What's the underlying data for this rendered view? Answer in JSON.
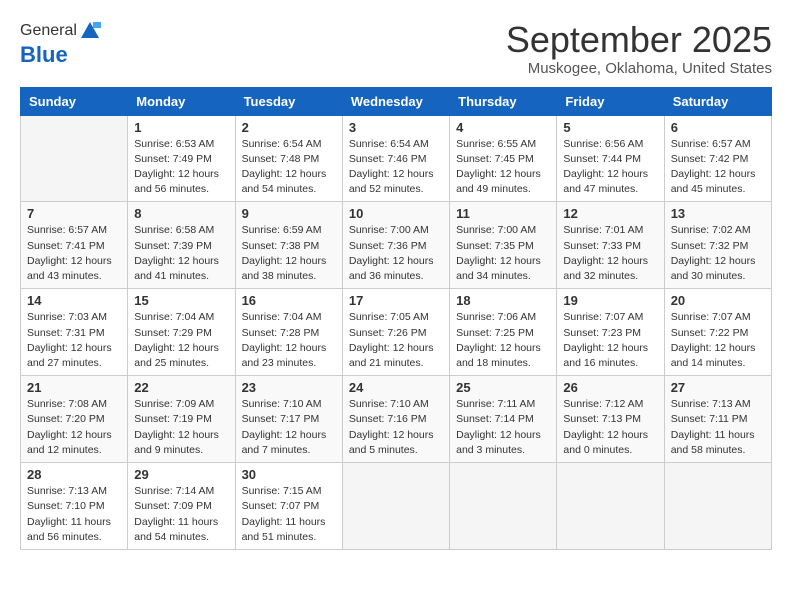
{
  "header": {
    "logo_general": "General",
    "logo_blue": "Blue",
    "month_title": "September 2025",
    "location": "Muskogee, Oklahoma, United States"
  },
  "weekdays": [
    "Sunday",
    "Monday",
    "Tuesday",
    "Wednesday",
    "Thursday",
    "Friday",
    "Saturday"
  ],
  "weeks": [
    [
      {
        "day": "",
        "info": ""
      },
      {
        "day": "1",
        "info": "Sunrise: 6:53 AM\nSunset: 7:49 PM\nDaylight: 12 hours\nand 56 minutes."
      },
      {
        "day": "2",
        "info": "Sunrise: 6:54 AM\nSunset: 7:48 PM\nDaylight: 12 hours\nand 54 minutes."
      },
      {
        "day": "3",
        "info": "Sunrise: 6:54 AM\nSunset: 7:46 PM\nDaylight: 12 hours\nand 52 minutes."
      },
      {
        "day": "4",
        "info": "Sunrise: 6:55 AM\nSunset: 7:45 PM\nDaylight: 12 hours\nand 49 minutes."
      },
      {
        "day": "5",
        "info": "Sunrise: 6:56 AM\nSunset: 7:44 PM\nDaylight: 12 hours\nand 47 minutes."
      },
      {
        "day": "6",
        "info": "Sunrise: 6:57 AM\nSunset: 7:42 PM\nDaylight: 12 hours\nand 45 minutes."
      }
    ],
    [
      {
        "day": "7",
        "info": "Sunrise: 6:57 AM\nSunset: 7:41 PM\nDaylight: 12 hours\nand 43 minutes."
      },
      {
        "day": "8",
        "info": "Sunrise: 6:58 AM\nSunset: 7:39 PM\nDaylight: 12 hours\nand 41 minutes."
      },
      {
        "day": "9",
        "info": "Sunrise: 6:59 AM\nSunset: 7:38 PM\nDaylight: 12 hours\nand 38 minutes."
      },
      {
        "day": "10",
        "info": "Sunrise: 7:00 AM\nSunset: 7:36 PM\nDaylight: 12 hours\nand 36 minutes."
      },
      {
        "day": "11",
        "info": "Sunrise: 7:00 AM\nSunset: 7:35 PM\nDaylight: 12 hours\nand 34 minutes."
      },
      {
        "day": "12",
        "info": "Sunrise: 7:01 AM\nSunset: 7:33 PM\nDaylight: 12 hours\nand 32 minutes."
      },
      {
        "day": "13",
        "info": "Sunrise: 7:02 AM\nSunset: 7:32 PM\nDaylight: 12 hours\nand 30 minutes."
      }
    ],
    [
      {
        "day": "14",
        "info": "Sunrise: 7:03 AM\nSunset: 7:31 PM\nDaylight: 12 hours\nand 27 minutes."
      },
      {
        "day": "15",
        "info": "Sunrise: 7:04 AM\nSunset: 7:29 PM\nDaylight: 12 hours\nand 25 minutes."
      },
      {
        "day": "16",
        "info": "Sunrise: 7:04 AM\nSunset: 7:28 PM\nDaylight: 12 hours\nand 23 minutes."
      },
      {
        "day": "17",
        "info": "Sunrise: 7:05 AM\nSunset: 7:26 PM\nDaylight: 12 hours\nand 21 minutes."
      },
      {
        "day": "18",
        "info": "Sunrise: 7:06 AM\nSunset: 7:25 PM\nDaylight: 12 hours\nand 18 minutes."
      },
      {
        "day": "19",
        "info": "Sunrise: 7:07 AM\nSunset: 7:23 PM\nDaylight: 12 hours\nand 16 minutes."
      },
      {
        "day": "20",
        "info": "Sunrise: 7:07 AM\nSunset: 7:22 PM\nDaylight: 12 hours\nand 14 minutes."
      }
    ],
    [
      {
        "day": "21",
        "info": "Sunrise: 7:08 AM\nSunset: 7:20 PM\nDaylight: 12 hours\nand 12 minutes."
      },
      {
        "day": "22",
        "info": "Sunrise: 7:09 AM\nSunset: 7:19 PM\nDaylight: 12 hours\nand 9 minutes."
      },
      {
        "day": "23",
        "info": "Sunrise: 7:10 AM\nSunset: 7:17 PM\nDaylight: 12 hours\nand 7 minutes."
      },
      {
        "day": "24",
        "info": "Sunrise: 7:10 AM\nSunset: 7:16 PM\nDaylight: 12 hours\nand 5 minutes."
      },
      {
        "day": "25",
        "info": "Sunrise: 7:11 AM\nSunset: 7:14 PM\nDaylight: 12 hours\nand 3 minutes."
      },
      {
        "day": "26",
        "info": "Sunrise: 7:12 AM\nSunset: 7:13 PM\nDaylight: 12 hours\nand 0 minutes."
      },
      {
        "day": "27",
        "info": "Sunrise: 7:13 AM\nSunset: 7:11 PM\nDaylight: 11 hours\nand 58 minutes."
      }
    ],
    [
      {
        "day": "28",
        "info": "Sunrise: 7:13 AM\nSunset: 7:10 PM\nDaylight: 11 hours\nand 56 minutes."
      },
      {
        "day": "29",
        "info": "Sunrise: 7:14 AM\nSunset: 7:09 PM\nDaylight: 11 hours\nand 54 minutes."
      },
      {
        "day": "30",
        "info": "Sunrise: 7:15 AM\nSunset: 7:07 PM\nDaylight: 11 hours\nand 51 minutes."
      },
      {
        "day": "",
        "info": ""
      },
      {
        "day": "",
        "info": ""
      },
      {
        "day": "",
        "info": ""
      },
      {
        "day": "",
        "info": ""
      }
    ]
  ]
}
